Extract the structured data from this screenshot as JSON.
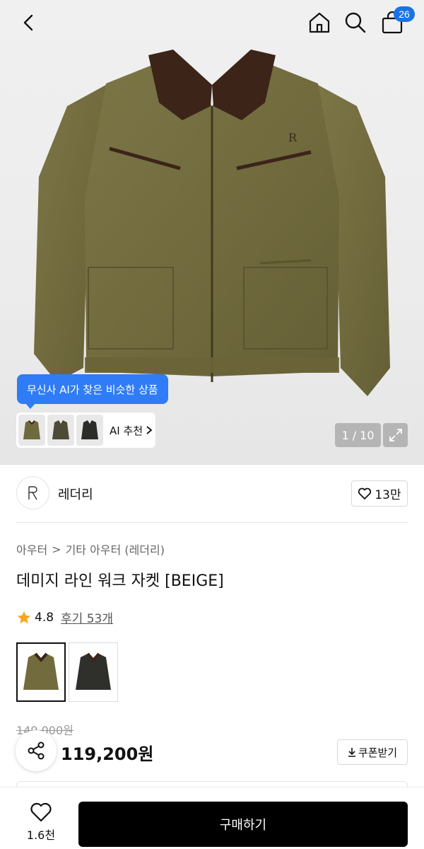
{
  "header": {
    "cart_count": "26"
  },
  "gallery": {
    "ai_tooltip": "무신사 AI가 찾은 비슷한 상품",
    "ai_recommend_label": "AI 추천",
    "counter": "1 / 10",
    "brand_mark": "R"
  },
  "brand": {
    "name": "레더리",
    "likes": "13만"
  },
  "breadcrumb": {
    "level1": "아우터",
    "separator": ">",
    "level2": "기타 아우터 (레더리)"
  },
  "product": {
    "title": "데미지 라인 워크 자켓 [BEIGE]",
    "rating": "4.8",
    "reviews": "후기 53개",
    "original_price": "149,000원",
    "price": "119,200원",
    "coupon_label": "쿠폰받기"
  },
  "bottom_bar": {
    "wish_count": "1.6천",
    "buy_label": "구매하기"
  },
  "colors": {
    "accent_blue": "#2f7cf6",
    "badge_blue": "#1a73e8",
    "star": "#f5a623",
    "buy_button": "#000000"
  }
}
